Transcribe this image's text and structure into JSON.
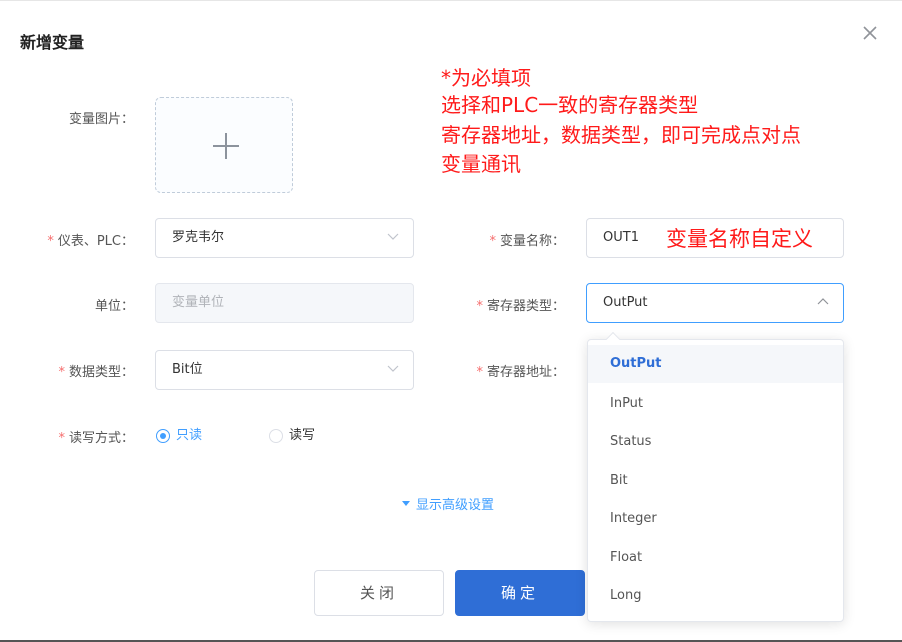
{
  "dialog": {
    "title": "新增变量"
  },
  "annotations": {
    "top_line1": "*为必填项",
    "top_line2": "选择和PLC一致的寄存器类型",
    "top_line3": "寄存器地址，数据类型，即可完成点对点",
    "top_line4": "变量通讯",
    "name_note": "变量名称自定义"
  },
  "form": {
    "image_label": "变量图片：",
    "meter_label": "仪表、PLC：",
    "meter_value": "罗克韦尔",
    "var_name_label": "变量名称：",
    "var_name_value": "OUT1",
    "unit_label": "单位：",
    "unit_placeholder": "变量单位",
    "register_type_label": "寄存器类型：",
    "register_type_value": "OutPut",
    "data_type_label": "数据类型：",
    "data_type_value": "Bit位",
    "register_addr_label": "寄存器地址：",
    "rw_label": "读写方式：",
    "rw_options": [
      "只读",
      "读写"
    ],
    "required_mark": "*"
  },
  "advanced_toggle": "显示高级设置",
  "buttons": {
    "cancel": "关闭",
    "ok": "确定"
  },
  "register_type_options": [
    "OutPut",
    "InPut",
    "Status",
    "Bit",
    "Integer",
    "Float",
    "Long"
  ],
  "colors": {
    "primary": "#2f6ed6",
    "accent": "#409eff",
    "required": "#f56c6c",
    "annotation": "#ff1a1a"
  }
}
